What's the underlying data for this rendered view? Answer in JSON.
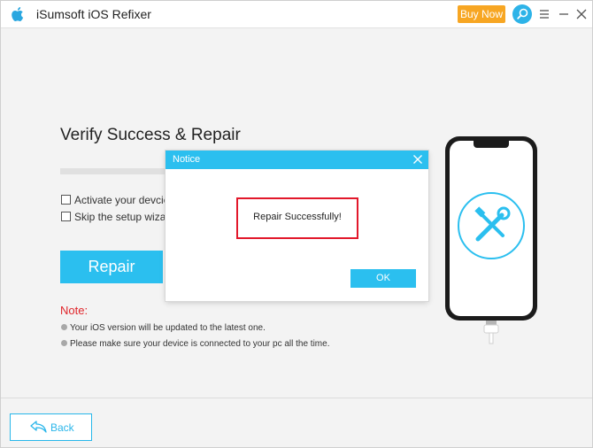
{
  "app": {
    "title": "iSumsoft iOS Refixer"
  },
  "titlebar": {
    "buy_label": "Buy Now"
  },
  "main": {
    "heading": "Verify Success & Repair",
    "progress": 0,
    "options": [
      {
        "label": "Activate your devcie at",
        "checked": false
      },
      {
        "label": "Skip the setup wizard a",
        "checked": false
      }
    ],
    "repair_label": "Repair",
    "note_label": "Note:",
    "notes": [
      "Your iOS version will be updated to the latest one.",
      "Please make sure your device is connected to your pc all the time."
    ]
  },
  "footer": {
    "back_label": "Back"
  },
  "dialog": {
    "title": "Notice",
    "message": "Repair Successfully!",
    "ok_label": "OK"
  },
  "icons": [
    "apple-logo-icon",
    "search-icon",
    "menu-icon",
    "minimize-icon",
    "close-icon",
    "tools-icon",
    "back-arrow-icon",
    "lightning-cable-icon"
  ],
  "colors": {
    "accent": "#2bbfef",
    "buy": "#f7a623",
    "note": "#e0262b",
    "highlight": "#e2182b"
  }
}
